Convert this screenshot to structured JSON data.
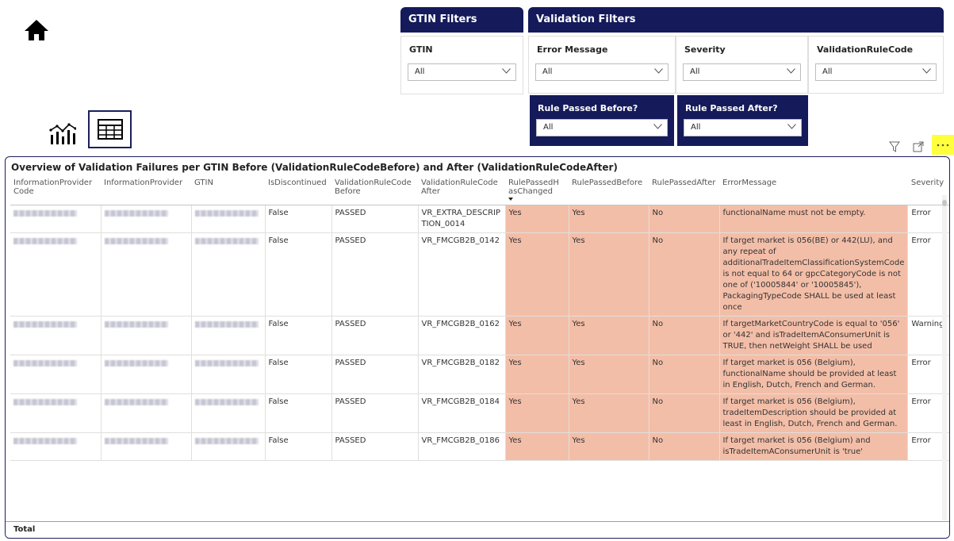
{
  "gtin_filters": {
    "title": "GTIN Filters",
    "gtin": {
      "label": "GTIN",
      "value": "All"
    }
  },
  "validation_filters": {
    "title": "Validation Filters",
    "error_message": {
      "label": "Error Message",
      "value": "All"
    },
    "severity": {
      "label": "Severity",
      "value": "All"
    },
    "validation_rule_code": {
      "label": "ValidationRuleCode",
      "value": "All"
    },
    "rule_passed_before": {
      "label": "Rule Passed Before?",
      "value": "All"
    },
    "rule_passed_after": {
      "label": "Rule Passed After?",
      "value": "All"
    }
  },
  "table": {
    "title": "Overview of Validation Failures per GTIN Before (ValidationRuleCodeBefore) and After (ValidationRuleCodeAfter)",
    "columns": [
      "InformationProvider Code",
      "InformationProvider",
      "GTIN",
      "IsDiscontinued",
      "ValidationRuleCode Before",
      "ValidationRuleCode After",
      "RulePassedH asChanged",
      "RulePassedBefore",
      "RulePassedAfter",
      "ErrorMessage",
      "Severity"
    ],
    "rows": [
      {
        "disc": "False",
        "before": "PASSED",
        "after": "VR_EXTRA_DESCRIP TION_0014",
        "changed": "Yes",
        "pbefore": "Yes",
        "pafter": "No",
        "msg": "functionalName must not be empty.",
        "sev": "Error"
      },
      {
        "disc": "False",
        "before": "PASSED",
        "after": "VR_FMCGB2B_0142",
        "changed": "Yes",
        "pbefore": "Yes",
        "pafter": "No",
        "msg": "If target market is 056(BE) or 442(LU), and any repeat of additionalTradeItemClassificationSystemCode is not equal to 64 or gpcCategoryCode is not one of ('10005844' or '10005845'), PackagingTypeCode SHALL be used at least once",
        "sev": "Error"
      },
      {
        "disc": "False",
        "before": "PASSED",
        "after": "VR_FMCGB2B_0162",
        "changed": "Yes",
        "pbefore": "Yes",
        "pafter": "No",
        "msg": "If targetMarketCountryCode is equal to '056' or '442' and isTradeItemAConsumerUnit is TRUE, then netWeight SHALL be used",
        "sev": "Warning"
      },
      {
        "disc": "False",
        "before": "PASSED",
        "after": "VR_FMCGB2B_0182",
        "changed": "Yes",
        "pbefore": "Yes",
        "pafter": "No",
        "msg": "If target market is 056 (Belgium), functionalName should be provided at least in English, Dutch, French and German.",
        "sev": "Error"
      },
      {
        "disc": "False",
        "before": "PASSED",
        "after": "VR_FMCGB2B_0184",
        "changed": "Yes",
        "pbefore": "Yes",
        "pafter": "No",
        "msg": "If target market is 056 (Belgium), tradeItemDescription should be provided at least in English, Dutch, French and German.",
        "sev": "Error"
      },
      {
        "disc": "False",
        "before": "PASSED",
        "after": "VR_FMCGB2B_0186",
        "changed": "Yes",
        "pbefore": "Yes",
        "pafter": "No",
        "msg": "If target market is 056 (Belgium) and isTradeItemAConsumerUnit is 'true'",
        "sev": "Error"
      }
    ],
    "total_label": "Total"
  },
  "colors": {
    "navy": "#141a5a",
    "highlight": "#f3bea8",
    "more_button": "#ffff3c"
  },
  "icons": [
    "home-icon",
    "chart-icon",
    "table-icon",
    "filter-icon",
    "focus-mode-icon",
    "more-options-icon",
    "chevron-down-icon"
  ]
}
